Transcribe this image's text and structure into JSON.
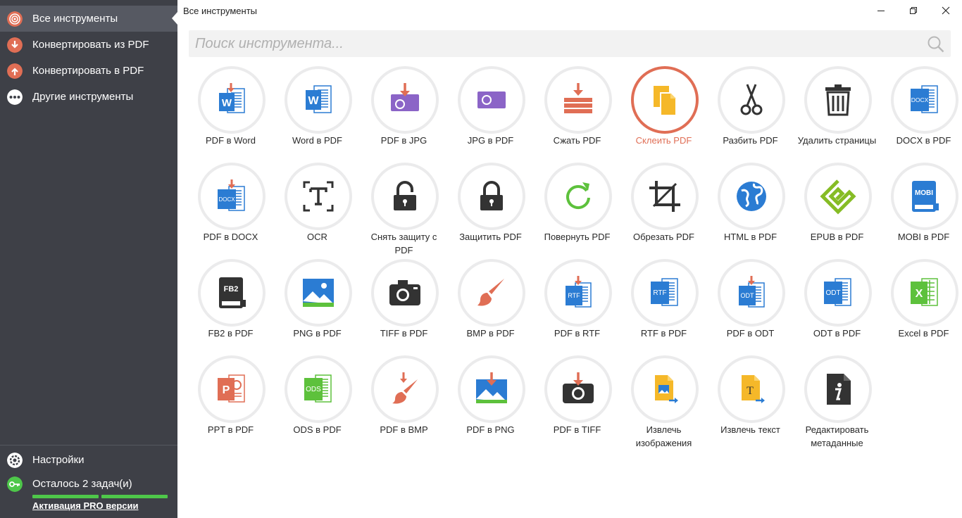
{
  "window": {
    "title": "Все инструменты"
  },
  "sidebar": {
    "items": [
      {
        "label": "Все инструменты",
        "icon": "all-tools-icon",
        "color": "#e06e55"
      },
      {
        "label": "Конвертировать из PDF",
        "icon": "convert-from-pdf-icon",
        "color": "#e06e55"
      },
      {
        "label": "Конвертировать в PDF",
        "icon": "convert-to-pdf-icon",
        "color": "#e06e55"
      },
      {
        "label": "Другие инструменты",
        "icon": "more-icon",
        "color": "#ffffff"
      }
    ],
    "settings_label": "Настройки",
    "tasks_label": "Осталось 2 задач(и)",
    "activate_label": "Активация PRO версии"
  },
  "search": {
    "placeholder": "Поиск инструмента..."
  },
  "tools": [
    {
      "label": "PDF в Word",
      "icon": "pdf-to-word-icon"
    },
    {
      "label": "Word в PDF",
      "icon": "word-to-pdf-icon"
    },
    {
      "label": "PDF в JPG",
      "icon": "pdf-to-jpg-icon"
    },
    {
      "label": "JPG в PDF",
      "icon": "jpg-to-pdf-icon"
    },
    {
      "label": "Сжать PDF",
      "icon": "compress-pdf-icon"
    },
    {
      "label": "Склеить PDF",
      "icon": "merge-pdf-icon",
      "highlighted": true
    },
    {
      "label": "Разбить PDF",
      "icon": "scissors-icon"
    },
    {
      "label": "Удалить страницы",
      "icon": "trash-icon"
    },
    {
      "label": "DOCX в PDF",
      "icon": "docx-to-pdf-icon"
    },
    {
      "label": "PDF в DOCX",
      "icon": "pdf-to-docx-icon"
    },
    {
      "label": "OCR",
      "icon": "ocr-icon"
    },
    {
      "label": "Снять защиту с PDF",
      "icon": "unlock-icon"
    },
    {
      "label": "Защитить PDF",
      "icon": "lock-icon"
    },
    {
      "label": "Повернуть PDF",
      "icon": "rotate-icon"
    },
    {
      "label": "Обрезать PDF",
      "icon": "crop-icon"
    },
    {
      "label": "HTML в PDF",
      "icon": "globe-icon"
    },
    {
      "label": "EPUB в PDF",
      "icon": "epub-icon"
    },
    {
      "label": "MOBI в PDF",
      "icon": "mobi-icon"
    },
    {
      "label": "FB2 в PDF",
      "icon": "fb2-icon"
    },
    {
      "label": "PNG в PDF",
      "icon": "png-image-icon"
    },
    {
      "label": "TIFF в PDF",
      "icon": "camera-icon"
    },
    {
      "label": "BMP в PDF",
      "icon": "brush-icon"
    },
    {
      "label": "PDF в RTF",
      "icon": "pdf-to-rtf-icon"
    },
    {
      "label": "RTF в PDF",
      "icon": "rtf-to-pdf-icon"
    },
    {
      "label": "PDF в ODT",
      "icon": "pdf-to-odt-icon"
    },
    {
      "label": "ODT в PDF",
      "icon": "odt-to-pdf-icon"
    },
    {
      "label": "Excel в PDF",
      "icon": "excel-icon"
    },
    {
      "label": "PPT в PDF",
      "icon": "powerpoint-icon"
    },
    {
      "label": "ODS в PDF",
      "icon": "ods-icon"
    },
    {
      "label": "PDF в BMP",
      "icon": "pdf-to-bmp-icon"
    },
    {
      "label": "PDF в PNG",
      "icon": "pdf-to-png-icon"
    },
    {
      "label": "PDF в TIFF",
      "icon": "pdf-to-tiff-icon"
    },
    {
      "label": "Извлечь изображения",
      "icon": "extract-images-icon"
    },
    {
      "label": "Извлечь текст",
      "icon": "extract-text-icon"
    },
    {
      "label": "Редактировать метаданные",
      "icon": "metadata-icon"
    }
  ]
}
